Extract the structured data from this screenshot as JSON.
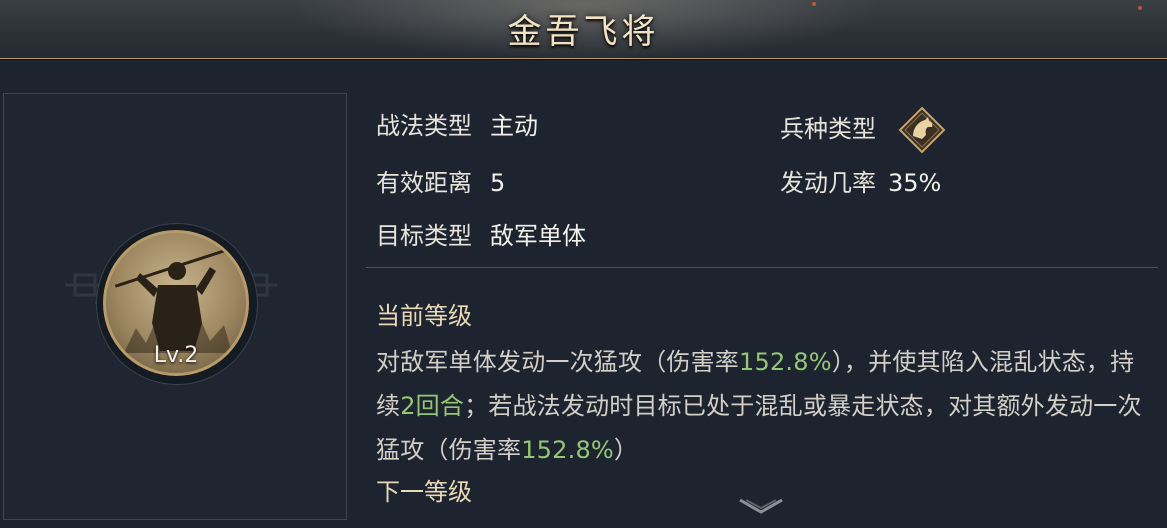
{
  "title": "金吾飞将",
  "level_label": "Lv.2",
  "attributes": {
    "tactic_type": {
      "label": "战法类型",
      "value": "主动"
    },
    "range": {
      "label": "有效距离",
      "value": "5"
    },
    "target_type": {
      "label": "目标类型",
      "value": "敌军单体"
    },
    "troop_type": {
      "label": "兵种类型",
      "icon": "cavalry-horse-icon"
    },
    "trigger_rate": {
      "label": "发动几率",
      "value": "35%"
    }
  },
  "current_level": {
    "heading": "当前等级",
    "segments": [
      {
        "text": "对敌军单体发动一次猛攻（伤害率",
        "highlight": false
      },
      {
        "text": "152.8%",
        "highlight": true
      },
      {
        "text": "），并使其陷入混乱状态，持续",
        "highlight": false
      },
      {
        "text": "2回合",
        "highlight": true
      },
      {
        "text": "；若战法发动时目标已处于混乱或暴走状态，对其额外发动一次猛攻（伤害率",
        "highlight": false
      },
      {
        "text": "152.8%",
        "highlight": true
      },
      {
        "text": "）",
        "highlight": false
      }
    ]
  },
  "next_level": {
    "heading": "下一等级"
  },
  "colors": {
    "highlight": "#93c774",
    "gold": "#b99a69",
    "background": "#1d2430"
  }
}
